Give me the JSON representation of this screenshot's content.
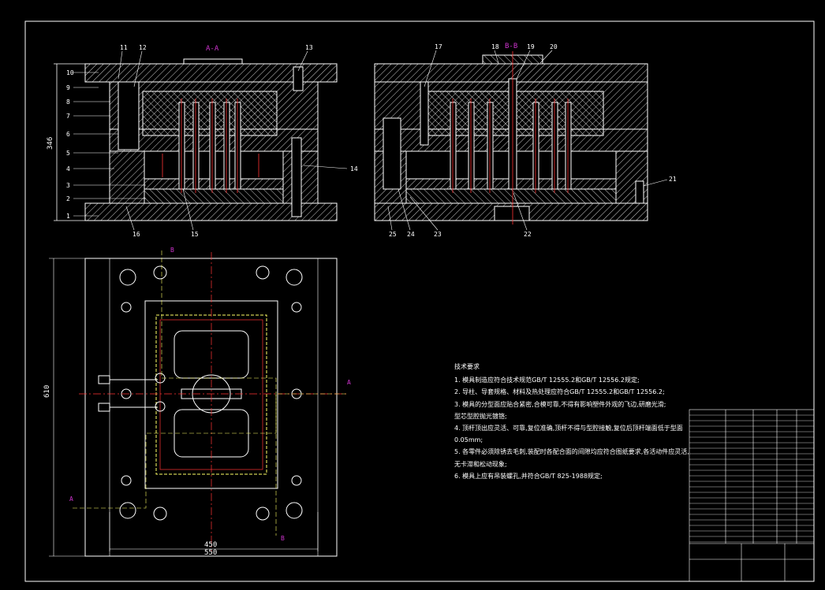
{
  "drawing": {
    "section_aa_title": "A-A",
    "section_bb_title": "B-B",
    "dimensions": {
      "height_346": "346",
      "height_610": "610",
      "width_450": "450",
      "width_550": "550"
    },
    "section_markers": {
      "a": "A",
      "b": "B"
    },
    "part_callouts_left": [
      "10",
      "9",
      "8",
      "7",
      "6",
      "5",
      "4",
      "3",
      "2",
      "1"
    ],
    "part_callouts_top": [
      "11",
      "12",
      "13"
    ],
    "part_callouts_bottom": [
      "16",
      "15"
    ],
    "part_callout_right": "14",
    "part_callouts_bb_top": [
      "17",
      "18",
      "19",
      "20"
    ],
    "part_callouts_bb_bottom": [
      "25",
      "24",
      "23",
      "22"
    ],
    "part_callout_bb_right": "21"
  },
  "notes": {
    "title": "技术要求",
    "lines": [
      "1. 模具制造应符合技术规范GB/T 12555.2和GB/T 12556.2规定;",
      "2. 导柱、导套规格、材料及热处理应符合GB/T 12555.2和GB/T 12556.2;",
      "3. 模具的分型面应贴合紧密,合模可靠,不得有影响塑件外观的飞边,研磨光滑;",
      "   型芯型腔抛光镀铬;",
      "4. 顶杆顶出应灵活、可靠,复位准确,顶杆不得与型腔接触,复位后顶杆端面低于型面",
      "   0.05mm;",
      "5. 各零件必须除锈去毛刺,装配时各配合面的间隙均应符合图纸要求,各活动件应灵活,",
      "   无卡滞和松动现象;",
      "6. 模具上应有吊装螺孔,并符合GB/T 825-1988规定;"
    ]
  },
  "colors": {
    "lines": "#ffffff",
    "hatch": "#ffffff",
    "center_lines": "#ff3333",
    "section_markers": "#cc33cc",
    "dim_lines": "#ffffff",
    "hidden_lines": "#ffff66"
  }
}
